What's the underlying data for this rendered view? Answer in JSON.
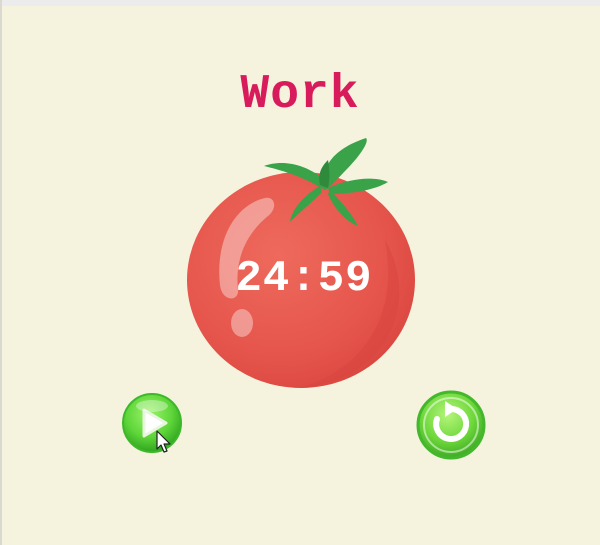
{
  "timer": {
    "mode_label": "Work",
    "time_remaining": "24:59"
  },
  "controls": {
    "play_icon": "play-icon",
    "reset_icon": "reset-icon"
  },
  "colors": {
    "background": "#f5f3de",
    "mode_label": "#d81b5a",
    "tomato": "#e5534b",
    "leaves": "#3aa34a",
    "button_green": "#5fd63a",
    "timer_text": "#ffffff"
  }
}
